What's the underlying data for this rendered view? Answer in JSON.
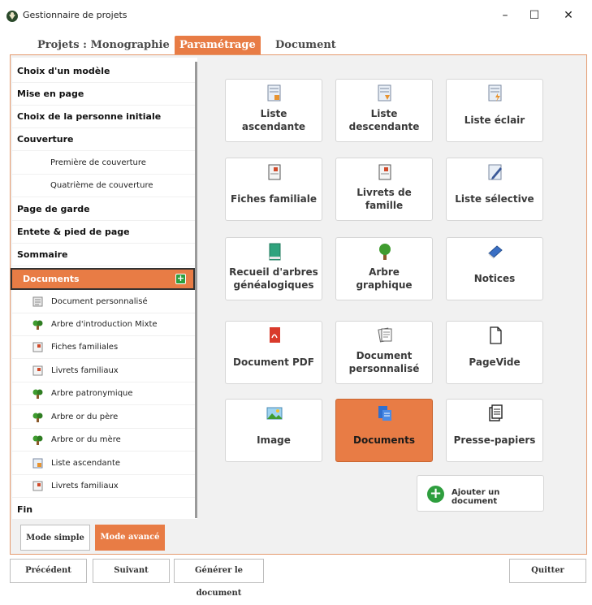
{
  "window": {
    "title": "Gestionnaire de projets",
    "controls": {
      "minimize": "–",
      "maximize": "☐",
      "close": "✕"
    }
  },
  "tabs": [
    {
      "label": "Projets : Monographie",
      "active": false
    },
    {
      "label": "Paramétrage",
      "active": true
    },
    {
      "label": "Document",
      "active": false
    }
  ],
  "sidebar": {
    "items": [
      {
        "label": "Choix d'un modèle"
      },
      {
        "label": "Mise en page"
      },
      {
        "label": "Choix de la personne initiale"
      },
      {
        "label": "Couverture"
      },
      {
        "label": "Première de couverture"
      },
      {
        "label": "Quatrième de couverture"
      },
      {
        "label": "Page de garde"
      },
      {
        "label": "Entete & pied de page"
      },
      {
        "label": "Sommaire"
      },
      {
        "label": "Documents",
        "active": true
      },
      {
        "label": "Document personnalisé",
        "icon": "document-icon"
      },
      {
        "label": "Arbre d'introduction Mixte",
        "icon": "tree-icon"
      },
      {
        "label": "Fiches familiales",
        "icon": "family-sheet-icon"
      },
      {
        "label": "Livrets familiaux",
        "icon": "family-book-icon"
      },
      {
        "label": "Arbre patronymique",
        "icon": "tree-icon"
      },
      {
        "label": "Arbre or du père",
        "icon": "tree-icon"
      },
      {
        "label": "Arbre or du mère",
        "icon": "tree-icon"
      },
      {
        "label": "Liste ascendante",
        "icon": "list-icon"
      },
      {
        "label": "Livrets familiaux",
        "icon": "family-book-icon"
      },
      {
        "label": "Fin"
      }
    ]
  },
  "mode": {
    "simple": "Mode simple",
    "avance": "Mode avancé"
  },
  "cards": [
    {
      "label": "Liste ascendante",
      "icon": "ascending-list-icon"
    },
    {
      "label": "Liste descendante",
      "icon": "descending-list-icon"
    },
    {
      "label": "Liste éclair",
      "icon": "flash-list-icon"
    },
    {
      "label": "Fiches familiale",
      "icon": "family-sheet-icon"
    },
    {
      "label": "Livrets de famille",
      "icon": "family-book-icon"
    },
    {
      "label": "Liste sélective",
      "icon": "selective-list-icon"
    },
    {
      "label": "Recueil d'arbres généalogiques",
      "icon": "green-book-icon"
    },
    {
      "label": "Arbre graphique",
      "icon": "tree-icon"
    },
    {
      "label": "Notices",
      "icon": "blue-book-icon"
    },
    {
      "label": "Document PDF",
      "icon": "pdf-icon"
    },
    {
      "label": "Document personnalisé",
      "icon": "custom-document-icon"
    },
    {
      "label": "PageVide",
      "icon": "blank-page-icon"
    },
    {
      "label": "Image",
      "icon": "image-icon"
    },
    {
      "label": "Documents",
      "icon": "documents-icon",
      "active": true
    },
    {
      "label": "Presse-papiers",
      "icon": "clipboard-icon"
    }
  ],
  "add_document": {
    "label": "Ajouter un document"
  },
  "bottom": {
    "prev": "Précédent",
    "next": "Suivant",
    "generate": "Générer le document",
    "quit": "Quitter"
  },
  "colors": {
    "accent": "#e87c45",
    "frame_border": "#e59a6e",
    "panel_bg": "#f1f1f1",
    "green": "#2e9e3e"
  }
}
